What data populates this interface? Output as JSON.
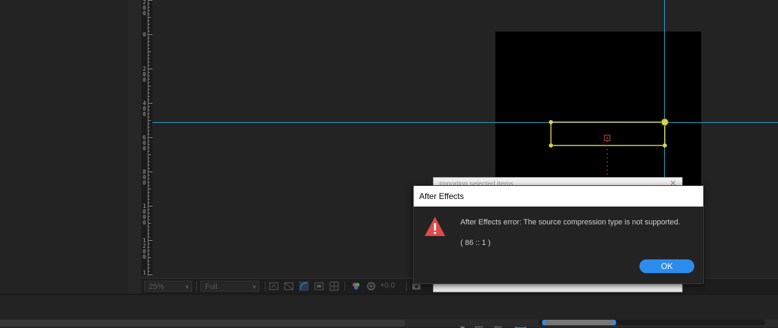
{
  "ruler": {
    "labels": [
      "2 0 0",
      "0",
      "2 0 0",
      "4 0 0",
      "6 0 0",
      "8 0 0",
      "1 0 0 0",
      "1 2 0 0",
      "1"
    ]
  },
  "toolbar": {
    "zoom": "25%",
    "resolution": "Full",
    "exposure": "+0.0"
  },
  "background_dialog": {
    "title": "Importing selected items",
    "close_glyph": "✕"
  },
  "dialog": {
    "title": "After Effects",
    "message": "After Effects error: The source compression type is not supported.",
    "code": "( 86 :: 1 )",
    "ok_label": "OK"
  },
  "colors": {
    "panel_bg": "#232323",
    "guide": "#29a9c9",
    "layer_outline": "#d9d44a",
    "anchor": "#e04a4a",
    "accent": "#2d8ceb",
    "warning": "#e04a4a"
  },
  "icons": {
    "warning": "warning-triangle-icon",
    "close": "close-icon"
  }
}
